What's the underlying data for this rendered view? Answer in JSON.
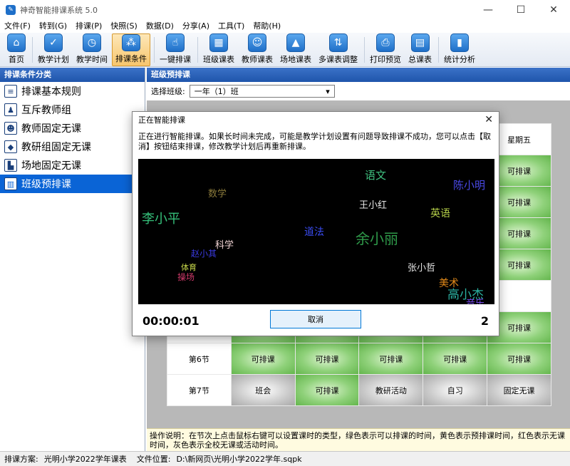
{
  "window": {
    "title": "神奇智能排课系统 5.0",
    "app_icon": "✎",
    "min": "—",
    "max": "☐",
    "close": "✕"
  },
  "menu": [
    "文件(F)",
    "转到(G)",
    "排课(P)",
    "快照(S)",
    "数据(D)",
    "分享(A)",
    "工具(T)",
    "帮助(H)"
  ],
  "toolbar": [
    {
      "label": "首页",
      "icon": "home-icon",
      "glyph": "⌂"
    },
    {
      "label": "教学计划",
      "icon": "clipboard-icon",
      "glyph": "✓"
    },
    {
      "label": "教学时间",
      "icon": "clock-icon",
      "glyph": "◷"
    },
    {
      "label": "排课条件",
      "icon": "network-icon",
      "glyph": "⁂",
      "active": true
    },
    {
      "label": "一键排课",
      "icon": "hand-pointer-icon",
      "glyph": "☝"
    },
    {
      "label": "班级课表",
      "icon": "calendar-grid-icon",
      "glyph": "▦"
    },
    {
      "label": "教师课表",
      "icon": "teacher-icon",
      "glyph": "☺"
    },
    {
      "label": "场地课表",
      "icon": "building-icon",
      "glyph": "▲"
    },
    {
      "label": "多课表调整",
      "icon": "multi-table-icon",
      "glyph": "⇅"
    },
    {
      "label": "打印预览",
      "icon": "printer-icon",
      "glyph": "⎙"
    },
    {
      "label": "总课表",
      "icon": "master-table-icon",
      "glyph": "▤"
    },
    {
      "label": "统计分析",
      "icon": "bar-chart-icon",
      "glyph": "▮"
    }
  ],
  "left": {
    "header": "排课条件分类",
    "items": [
      {
        "label": "排课基本规则",
        "icon": "rule-doc-icon",
        "glyph": "≡"
      },
      {
        "label": "互斥教师组",
        "icon": "teacher-group-icon",
        "glyph": "♟"
      },
      {
        "label": "教师固定无课",
        "icon": "teacher-fixed-icon",
        "glyph": "☻"
      },
      {
        "label": "教研组固定无课",
        "icon": "cube-icon",
        "glyph": "◆"
      },
      {
        "label": "场地固定无课",
        "icon": "venue-icon",
        "glyph": "▙"
      },
      {
        "label": "班级预排课",
        "icon": "book-icon",
        "glyph": "▥",
        "selected": true
      }
    ]
  },
  "main": {
    "header": "班级预排课",
    "class_label": "选择班级:",
    "class_value": "一年（1）班",
    "dropdown_arrow": "▾",
    "weekday_header": "星期五",
    "col5_cell": "可排课",
    "rows": [
      {
        "label": "第6节",
        "cells": [
          {
            "t": "可排课",
            "c": "green"
          },
          {
            "t": "可排课",
            "c": "green"
          },
          {
            "t": "可排课",
            "c": "green"
          },
          {
            "t": "可排课",
            "c": "green"
          },
          {
            "t": "可排课",
            "c": "green"
          }
        ]
      },
      {
        "label": "第7节",
        "cells": [
          {
            "t": "班会",
            "c": "gray"
          },
          {
            "t": "可排课",
            "c": "green"
          },
          {
            "t": "教研活动",
            "c": "gray"
          },
          {
            "t": "自习",
            "c": "gray"
          },
          {
            "t": "固定无课",
            "c": "gray"
          }
        ]
      }
    ],
    "help": "操作说明：在节次上点击鼠标右键可以设置课时的类型，绿色表示可以排课的时间，黄色表示预排课时间，红色表示无课时间，灰色表示全校无课或活动时间。"
  },
  "status": {
    "plan_label": "排课方案:",
    "plan_value": "光明小学2022学年课表",
    "file_label": "文件位置:",
    "file_value": "D:\\新网页\\光明小学2022学年.sqpk"
  },
  "dialog": {
    "title": "正在智能排课",
    "close": "✕",
    "message": "正在进行智能排课。如果长时间未完成，可能是教学计划设置有问题导致排课不成功，您可以点击【取消】按钮结束排课，修改教学计划后再重新排课。",
    "timer": "00:00:01",
    "cancel": "取消",
    "count": "2",
    "words": [
      {
        "t": "语文",
        "color": "#3fbf7f"
      },
      {
        "t": "陈小明",
        "color": "#4a4ae8"
      },
      {
        "t": "数学",
        "color": "#8a7a3a"
      },
      {
        "t": "王小红",
        "color": "#e6e6e6"
      },
      {
        "t": "英语",
        "color": "#b7d24a"
      },
      {
        "t": "李小平",
        "color": "#35c07a"
      },
      {
        "t": "道法",
        "color": "#3a4cf0"
      },
      {
        "t": "余小丽",
        "color": "#2f9a4a"
      },
      {
        "t": "科学",
        "color": "#f2d4d4"
      },
      {
        "t": "赵小其",
        "color": "#3a3ae0"
      },
      {
        "t": "张小哲",
        "color": "#e2e2e2"
      },
      {
        "t": "体育",
        "color": "#c8d84a"
      },
      {
        "t": "操场",
        "color": "#d03a6a"
      },
      {
        "t": "美术",
        "color": "#e28a1a"
      },
      {
        "t": "高小杰",
        "color": "#2ab0a0"
      },
      {
        "t": "音乐",
        "color": "#7a4af0"
      }
    ]
  }
}
